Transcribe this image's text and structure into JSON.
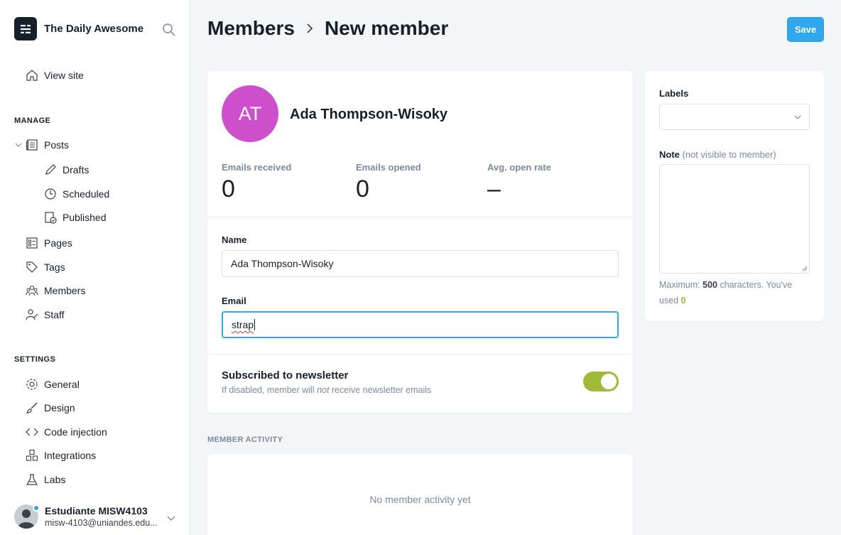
{
  "sidebar": {
    "brand": "The Daily Awesome",
    "view_site": "View site",
    "manage_heading": "MANAGE",
    "posts": "Posts",
    "drafts": "Drafts",
    "scheduled": "Scheduled",
    "published": "Published",
    "pages": "Pages",
    "tags": "Tags",
    "members": "Members",
    "staff": "Staff",
    "settings_heading": "SETTINGS",
    "general": "General",
    "design": "Design",
    "code_injection": "Code injection",
    "integrations": "Integrations",
    "labs": "Labs",
    "user_name": "Estudiante MISW4103",
    "user_email": "misw-4103@uniandes.edu..."
  },
  "header": {
    "crumb_parent": "Members",
    "crumb_current": "New member",
    "save_label": "Save"
  },
  "member": {
    "initials": "AT",
    "name": "Ada Thompson-Wisoky",
    "avatar_color": "#cd4fcb",
    "stats": [
      {
        "label": "Emails received",
        "value": "0"
      },
      {
        "label": "Emails opened",
        "value": "0"
      },
      {
        "label": "Avg. open rate",
        "value": "–"
      }
    ]
  },
  "form": {
    "name_label": "Name",
    "name_value": "Ada Thompson-Wisoky",
    "email_label": "Email",
    "email_value": "strap",
    "newsletter_title": "Subscribed to newsletter",
    "newsletter_desc_pre": "If disabled, member will ",
    "newsletter_desc_em": "not",
    "newsletter_desc_post": " receive newsletter emails",
    "newsletter_on": true
  },
  "side": {
    "labels_label": "Labels",
    "note_label": "Note",
    "note_hint": "(not visible to member)",
    "max_pre": "Maximum: ",
    "max_count": "500",
    "max_mid": " characters. You've used ",
    "used_count": "0"
  },
  "activity": {
    "heading": "MEMBER ACTIVITY",
    "empty": "No member activity yet"
  },
  "colors": {
    "accent": "#30a8ee",
    "toggle_on": "#9fbb36"
  }
}
